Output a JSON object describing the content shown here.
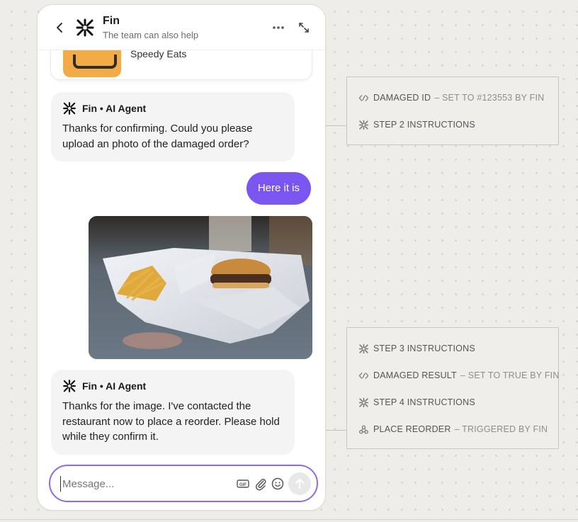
{
  "header": {
    "title": "Fin",
    "subtitle": "The team can also help"
  },
  "previous_card": {
    "merchant": "Speedy Eats"
  },
  "messages": [
    {
      "sender": "Fin • AI Agent",
      "text": "Thanks for confirming. Could you please upload an photo of the damaged order?"
    },
    {
      "sender": "Fin • AI Agent",
      "text": "Thanks for the image. I've contacted the restaurant now to place a reorder. Please hold while they confirm it."
    }
  ],
  "user_message": "Here it is",
  "composer": {
    "placeholder": "Message..."
  },
  "panels": [
    {
      "rows": [
        {
          "icon": "code-icon",
          "label": "DAMAGED ID",
          "detail": "– SET TO #123553 BY FIN"
        },
        {
          "icon": "fin-logo-icon",
          "label": "STEP 2 INSTRUCTIONS",
          "detail": ""
        }
      ]
    },
    {
      "rows": [
        {
          "icon": "fin-logo-icon",
          "label": "STEP 3 INSTRUCTIONS",
          "detail": ""
        },
        {
          "icon": "code-icon",
          "label": "DAMAGED RESULT",
          "detail": "– SET TO TRUE BY FIN"
        },
        {
          "icon": "fin-logo-icon",
          "label": "STEP 4 INSTRUCTIONS",
          "detail": ""
        },
        {
          "icon": "webhook-icon",
          "label": "PLACE REORDER",
          "detail": "– TRIGGERED BY FIN"
        }
      ]
    }
  ],
  "colors": {
    "accent": "#7b55f0",
    "composer_border": "#8a6af0",
    "background": "#efede7"
  }
}
